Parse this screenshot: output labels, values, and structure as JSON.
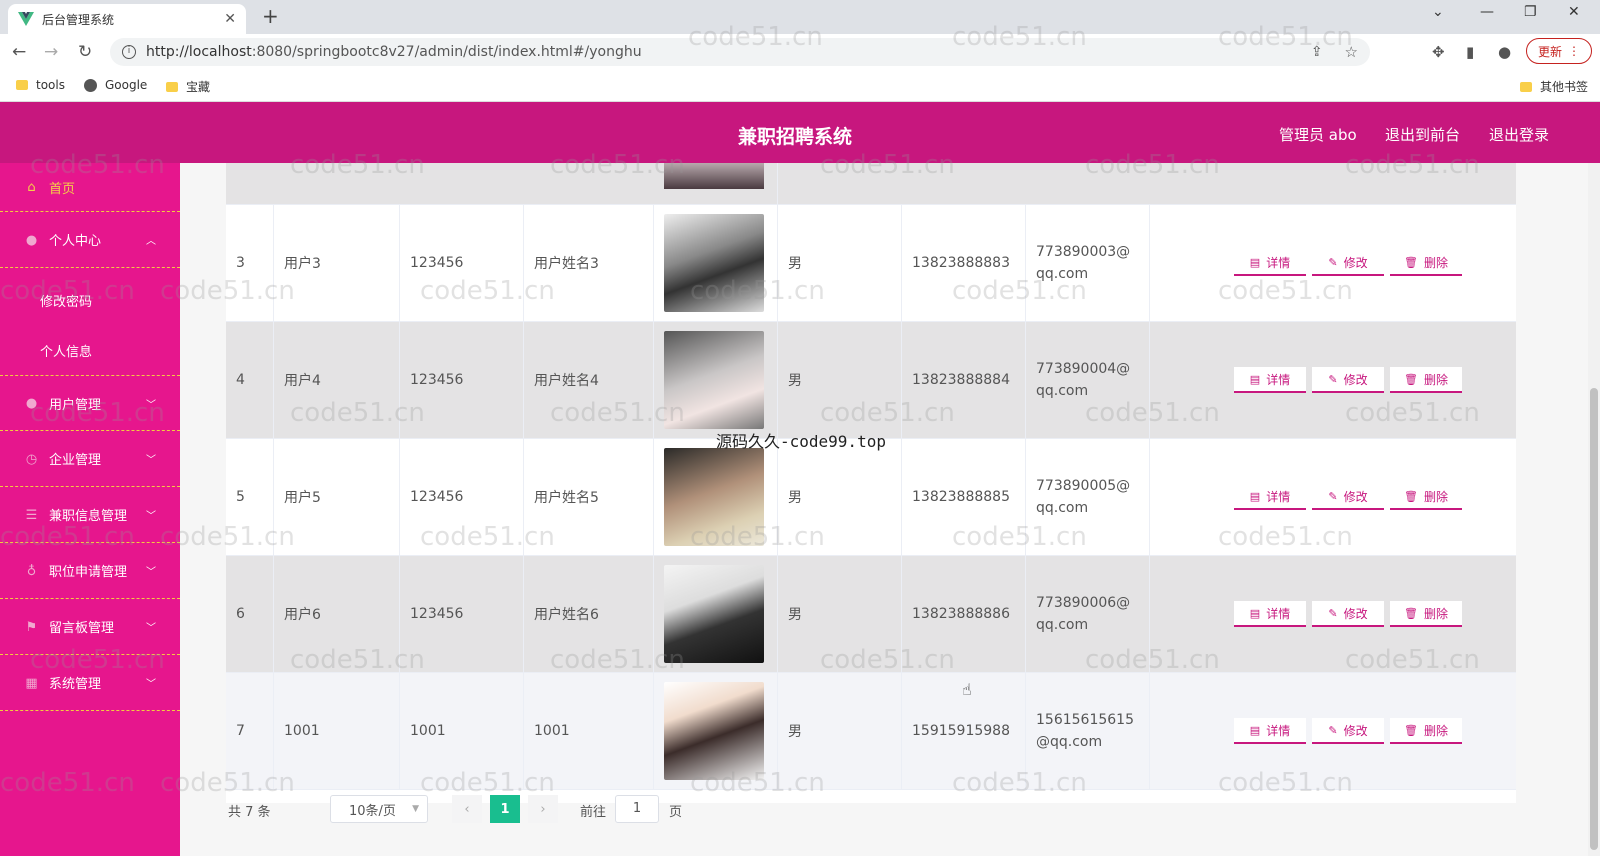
{
  "browser": {
    "tab_title": "后台管理系统",
    "tab_close": "✕",
    "new_tab": "+",
    "url_host": "http://localhost",
    "url_path": ":8080/springbootc8v27/admin/dist/index.html#/yonghu",
    "update_label": "更新",
    "bookmarks": [
      "tools",
      "Google",
      "宝藏"
    ],
    "other_bookmarks": "其他书签",
    "accent": "#c5221f"
  },
  "header": {
    "title": "兼职招聘系统",
    "admin": "管理员 abo",
    "to_front": "退出到前台",
    "logout": "退出登录",
    "color": "#c7177e"
  },
  "sidebar": {
    "color": "#e6168d",
    "home": "首页",
    "items": [
      {
        "label": "个人中心",
        "icon": "user-icon"
      },
      {
        "label": "用户管理",
        "icon": "user-icon"
      },
      {
        "label": "企业管理",
        "icon": "clock-icon"
      },
      {
        "label": "兼职信息管理",
        "icon": "sliders-icon"
      },
      {
        "label": "职位申请管理",
        "icon": "mic-icon"
      },
      {
        "label": "留言板管理",
        "icon": "flag-icon"
      },
      {
        "label": "系统管理",
        "icon": "grid-icon"
      }
    ],
    "sub_items": [
      "修改密码",
      "个人信息"
    ]
  },
  "table": {
    "rows": [
      {
        "no": "3",
        "account": "用户3",
        "password": "123456",
        "name": "用户姓名3",
        "gender": "男",
        "phone": "13823888883",
        "email": "773890003@qq.com"
      },
      {
        "no": "4",
        "account": "用户4",
        "password": "123456",
        "name": "用户姓名4",
        "gender": "男",
        "phone": "13823888884",
        "email": "773890004@qq.com"
      },
      {
        "no": "5",
        "account": "用户5",
        "password": "123456",
        "name": "用户姓名5",
        "gender": "男",
        "phone": "13823888885",
        "email": "773890005@qq.com"
      },
      {
        "no": "6",
        "account": "用户6",
        "password": "123456",
        "name": "用户姓名6",
        "gender": "男",
        "phone": "13823888886",
        "email": "773890006@qq.com"
      },
      {
        "no": "7",
        "account": "1001",
        "password": "1001",
        "name": "1001",
        "gender": "男",
        "phone": "15915915988",
        "email": "15615615615@qq.com"
      }
    ],
    "actions": {
      "detail": "详情",
      "edit": "修改",
      "delete": "删除"
    }
  },
  "pager": {
    "total": "共 7 条",
    "page_size": "10条/页",
    "current_page": "1",
    "goto_label": "前往",
    "goto_value": "1",
    "page_unit": "页",
    "active_color": "#19be8f"
  },
  "watermark": {
    "text": "code51.cn",
    "center": "源码久久-code99.top"
  }
}
